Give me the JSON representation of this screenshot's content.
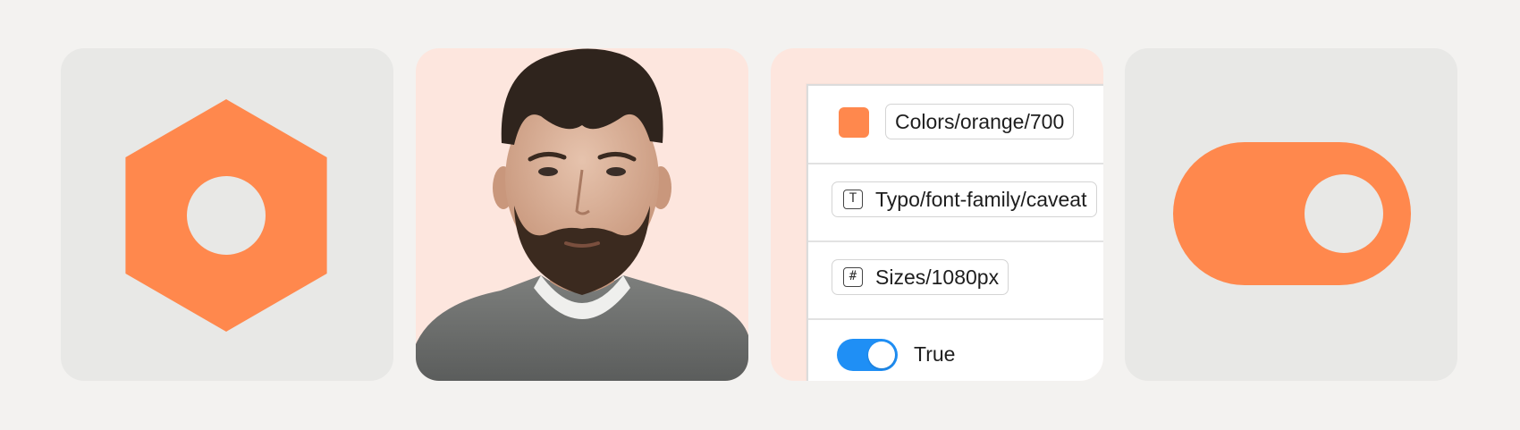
{
  "colors": {
    "background": "#f3f2f0",
    "card_neutral": "#e8e8e6",
    "card_peach": "#fde6de",
    "accent_orange": "#ff884d",
    "toggle_blue": "#1f8ff5"
  },
  "cards": [
    {
      "kind": "component",
      "icon": "hexagon-nut-icon"
    },
    {
      "kind": "image",
      "icon": "portrait-photo"
    },
    {
      "kind": "variables-panel"
    },
    {
      "kind": "boolean",
      "icon": "toggle-switch-icon"
    }
  ],
  "variables": {
    "color_variable": {
      "label": "Colors/orange/700",
      "swatch": "#ff884d"
    },
    "text_variable": {
      "label": "Typo/font-family/caveat",
      "icon": "text-type-icon",
      "icon_glyph": "T"
    },
    "number_variable": {
      "label": "Sizes/1080px",
      "icon": "number-hash-icon",
      "icon_glyph": "#"
    },
    "boolean_variable": {
      "label": "True",
      "value": true,
      "icon": "toggle-switch-icon"
    }
  }
}
